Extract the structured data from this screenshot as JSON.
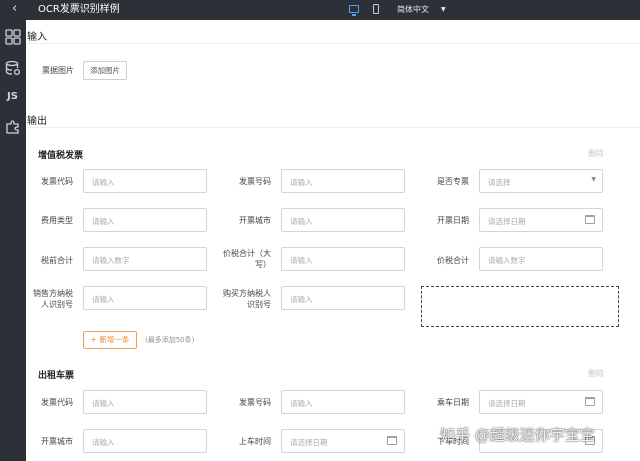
{
  "header": {
    "back_icon": "arrow-left-icon",
    "title": "OCR发票识别样例",
    "device_desktop_icon": "monitor-icon",
    "device_mobile_icon": "phone-icon",
    "language": "简体中文"
  },
  "sidebar": {
    "items": [
      {
        "icon": "grid-icon"
      },
      {
        "icon": "database-icon"
      },
      {
        "label": "JS"
      },
      {
        "icon": "puzzle-icon"
      }
    ]
  },
  "input_section": {
    "title": "输入",
    "receipt_label": "票据图片",
    "upload_button": "添加图片"
  },
  "output_section": {
    "title": "输出",
    "vat": {
      "title": "增值税发票",
      "delete": "删除",
      "fields": {
        "invoice_code": {
          "label": "发票代码",
          "placeholder": "请输入"
        },
        "invoice_number": {
          "label": "发票号码",
          "placeholder": "请输入"
        },
        "is_special": {
          "label": "是否专票",
          "placeholder": "请选择"
        },
        "expense_type": {
          "label": "费用类型",
          "placeholder": "请输入"
        },
        "invoice_city": {
          "label": "开票城市",
          "placeholder": "请输入"
        },
        "invoice_date": {
          "label": "开票日期",
          "placeholder": "请选择日期"
        },
        "pre_tax_total": {
          "label": "税前合计",
          "placeholder": "请输入数字"
        },
        "total_upper": {
          "label": "价税合计（大写）",
          "placeholder": "请输入"
        },
        "total": {
          "label": "价税合计",
          "placeholder": "请输入数字"
        },
        "seller_tax_id": {
          "label": "销售方纳税人识别号",
          "placeholder": "请输入"
        },
        "buyer_tax_id": {
          "label": "购买方纳税人识别号",
          "placeholder": "请输入"
        }
      },
      "add_button": "+ 新增一条",
      "add_note": "(最多添加50条)"
    },
    "taxi": {
      "title": "出租车票",
      "delete": "删除",
      "fields": {
        "invoice_code": {
          "label": "发票代码",
          "placeholder": "请输入"
        },
        "invoice_number": {
          "label": "发票号码",
          "placeholder": "请输入"
        },
        "ride_date": {
          "label": "乘车日期",
          "placeholder": "请选择日期"
        },
        "invoice_city": {
          "label": "开票城市",
          "placeholder": "请输入"
        },
        "boarding_time": {
          "label": "上车时间",
          "placeholder": "请选择日期"
        },
        "alighting_time": {
          "label": "下车时间",
          "placeholder": ""
        }
      }
    }
  },
  "watermark": "知乎 @超级迷你宇宝宝",
  "colors": {
    "topbar_bg": "#2c3138",
    "accent_blue": "#4aa3ff",
    "add_orange": "#ee8a2e",
    "input_border": "#cfd6dd"
  }
}
